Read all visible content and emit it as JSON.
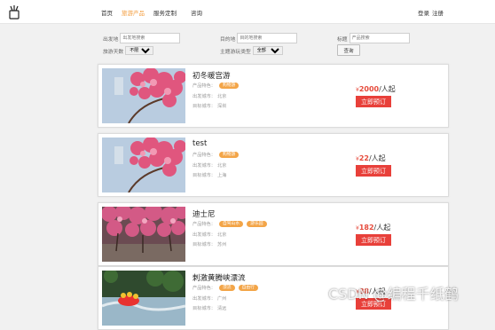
{
  "nav": {
    "home": "首页",
    "travel_products": "旅游产品",
    "custom_service": "服务定制",
    "consult": "咨询"
  },
  "auth": {
    "login": "登录",
    "register": "注册"
  },
  "filters": {
    "departure_label": "出发地",
    "departure_placeholder": "出发地搜索",
    "destination_label": "目的地",
    "destination_placeholder": "目的地搜索",
    "title_label": "标题",
    "title_placeholder": "产品搜索",
    "days_label": "旅游天数",
    "days_value": "不限",
    "theme_label": "主题游玩类型",
    "theme_value": "全部",
    "search_button": "查询"
  },
  "labels": {
    "feature": "产品特色：",
    "departure_city": "出发城市：",
    "destination_city": "目标城市：",
    "book_button": "立即预订",
    "per_person": "/人起",
    "currency": "¥"
  },
  "products": [
    {
      "title": "初冬暖宫游",
      "tags": [
        "购物游"
      ],
      "departure": "北京",
      "destination": "深圳",
      "price": "2000"
    },
    {
      "title": "test",
      "tags": [
        "购物游"
      ],
      "departure": "北京",
      "destination": "上海",
      "price": "22"
    },
    {
      "title": "迪士尼",
      "tags": [
        "自驾山水",
        "游乐园"
      ],
      "departure": "北京",
      "destination": "苏州",
      "price": "182"
    },
    {
      "title": "刺激黄腾峡漂流",
      "tags": [
        "漂流",
        "自由行"
      ],
      "departure": "广州",
      "destination": "清远",
      "price": "88"
    }
  ],
  "watermark": "CSDN @编程千纸鹤",
  "colors": {
    "accent": "#f39c3d",
    "price": "#e64b3c",
    "button": "#e8403a",
    "tag": "#f3a548"
  }
}
